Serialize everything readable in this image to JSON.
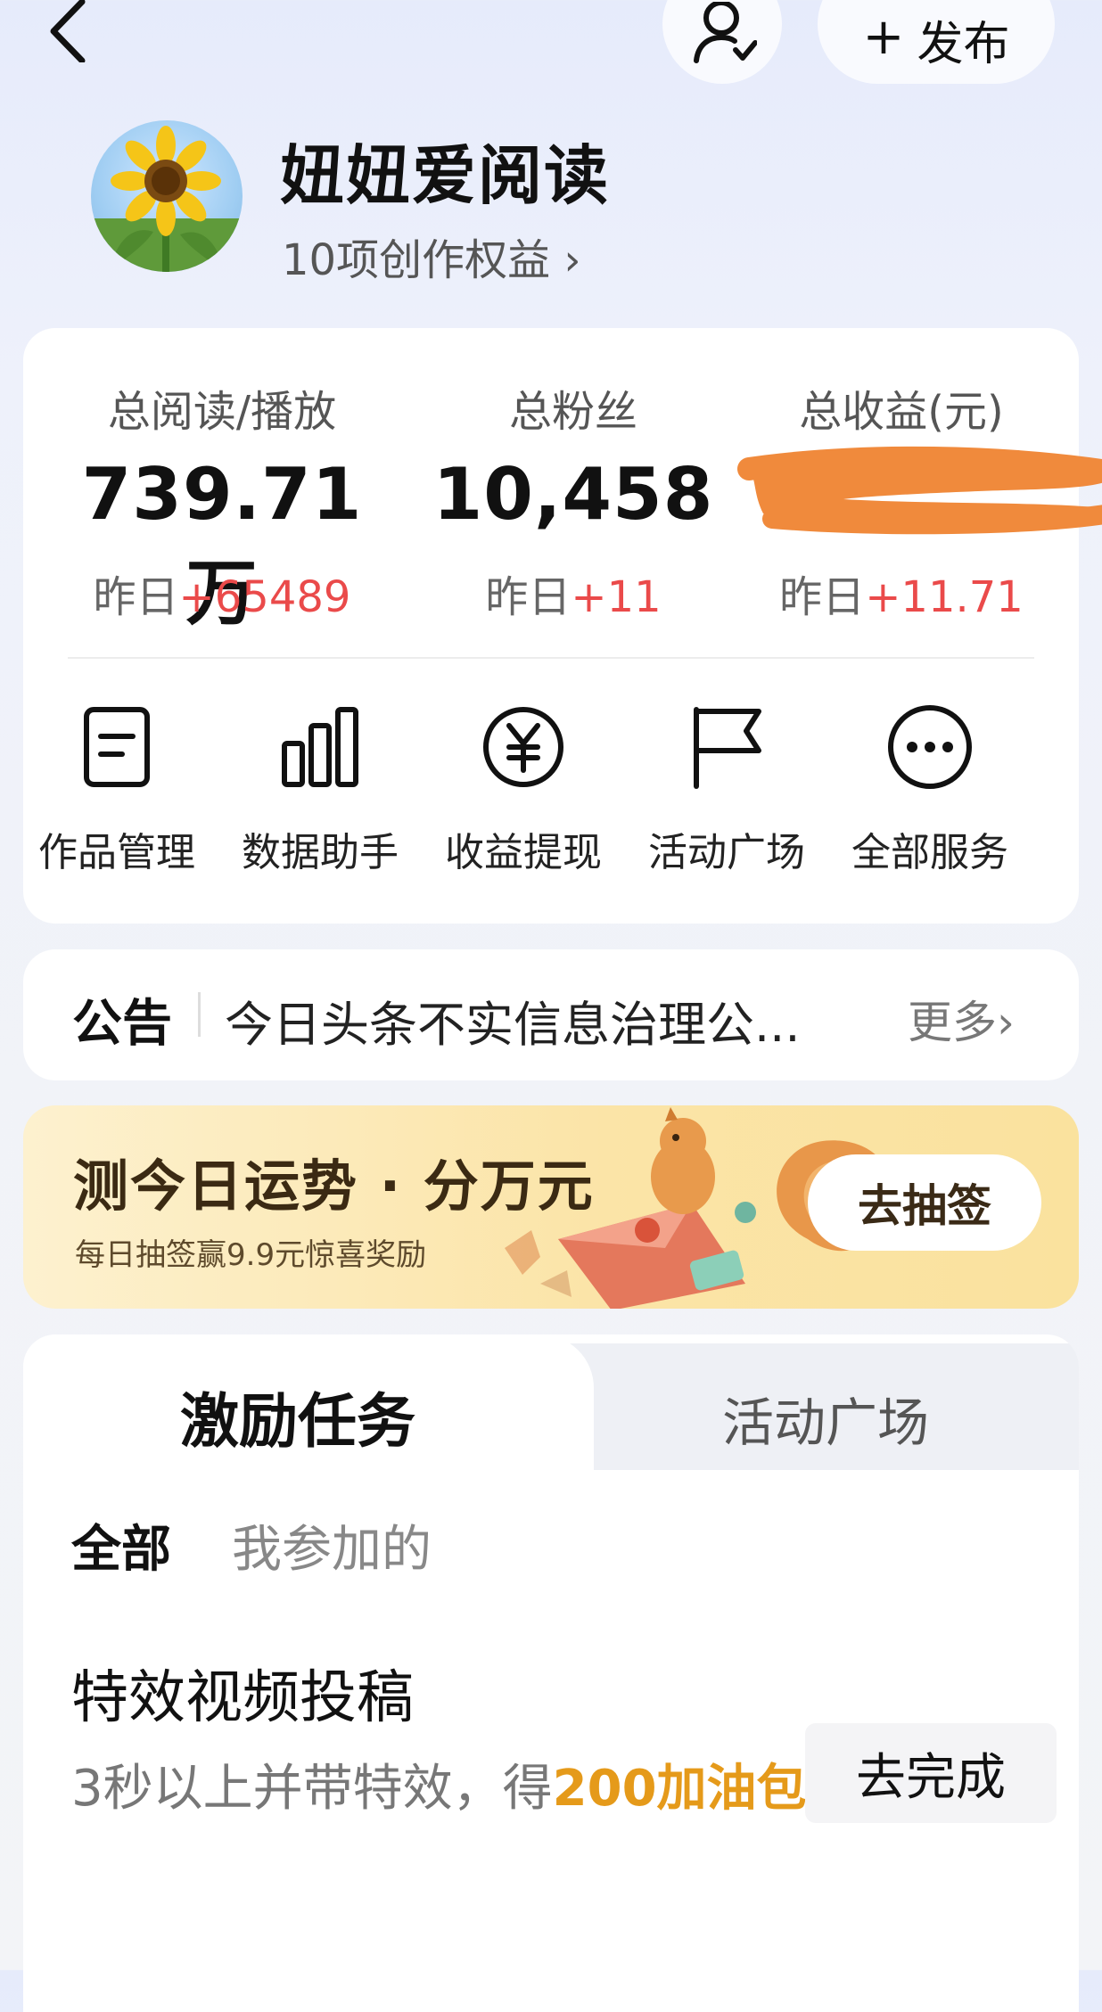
{
  "header": {
    "back_icon": "chevron-left-icon",
    "follow_icon": "user-check-icon",
    "publish_label": "发布"
  },
  "profile": {
    "name": "妞妞爱阅读",
    "rights": "10项创作权益 ›"
  },
  "stats": [
    {
      "label": "总阅读/播放",
      "value": "739.71万",
      "delta_prefix": "昨日",
      "delta": "+65489"
    },
    {
      "label": "总粉丝",
      "value": "10,458",
      "delta_prefix": "昨日",
      "delta": "+11"
    },
    {
      "label": "总收益(元)",
      "value": "",
      "delta_prefix": "昨日",
      "delta": "+11.71"
    }
  ],
  "services": [
    {
      "name": "作品管理",
      "icon": "document-icon"
    },
    {
      "name": "数据助手",
      "icon": "bar-chart-icon"
    },
    {
      "name": "收益提现",
      "icon": "yuan-circle-icon"
    },
    {
      "name": "活动广场",
      "icon": "flag-icon"
    },
    {
      "name": "全部服务",
      "icon": "more-circle-icon"
    }
  ],
  "notice": {
    "tag": "公告",
    "text": "今日头条不实信息治理公...",
    "more": "更多›"
  },
  "banner": {
    "title": "测今日运势 · 分万元",
    "subtitle": "每日抽签赢9.9元惊喜奖励",
    "button": "去抽签",
    "accent": "#fbe4a7"
  },
  "tasks": {
    "tabs": [
      "激励任务",
      "活动广场"
    ],
    "filters": [
      "全部",
      "我参加的"
    ],
    "item": {
      "title": "特效视频投稿",
      "desc": "3秒以上并带特效，得",
      "reward": "200加油包",
      "button": "去完成"
    }
  },
  "colors": {
    "positive": "#ea4a4a",
    "reward": "#e59a1a"
  }
}
